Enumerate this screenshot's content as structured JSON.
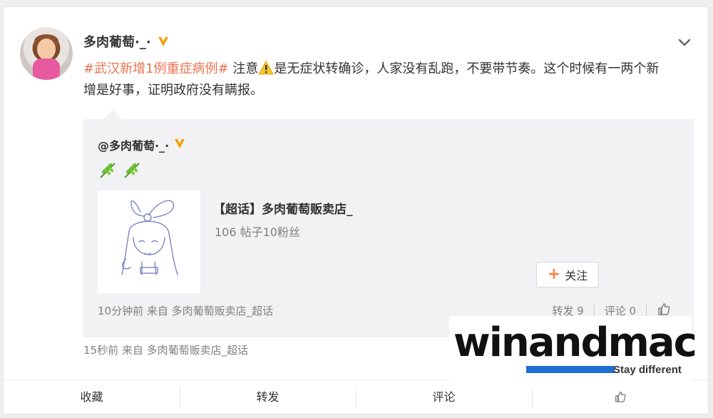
{
  "post": {
    "username": "多肉葡萄·_·",
    "hashtag": "#武汉新增1例重症病例#",
    "text_part1": " 注意",
    "text_part2": "是无症状转确诊，人家没有乱跑，不要带节奏。这个时候有一两个新增是好事，证明政府没有瞒报。",
    "footer": "15秒前  来自 多肉葡萄贩卖店_超话"
  },
  "repost": {
    "author": "@多肉葡萄·_·",
    "tag_title": "【超话】多肉葡萄贩卖店_",
    "tag_meta": "106 帖子10粉丝",
    "follow_label": "关注",
    "footer": "10分钟前 来自 多肉葡萄贩卖店_超话",
    "forward_label": "转发 9",
    "comment_label": "评论 0"
  },
  "bottom_bar": {
    "favorite": "收藏",
    "forward": "转发",
    "comment": "评论"
  },
  "watermark": {
    "brand": "winandmac",
    "tagline": "Stay different"
  },
  "colors": {
    "hashtag": "#eb7350",
    "verified": "#f5a000",
    "accent_plus": "#ff8140",
    "watermark_bar": "#1f6fd1"
  }
}
